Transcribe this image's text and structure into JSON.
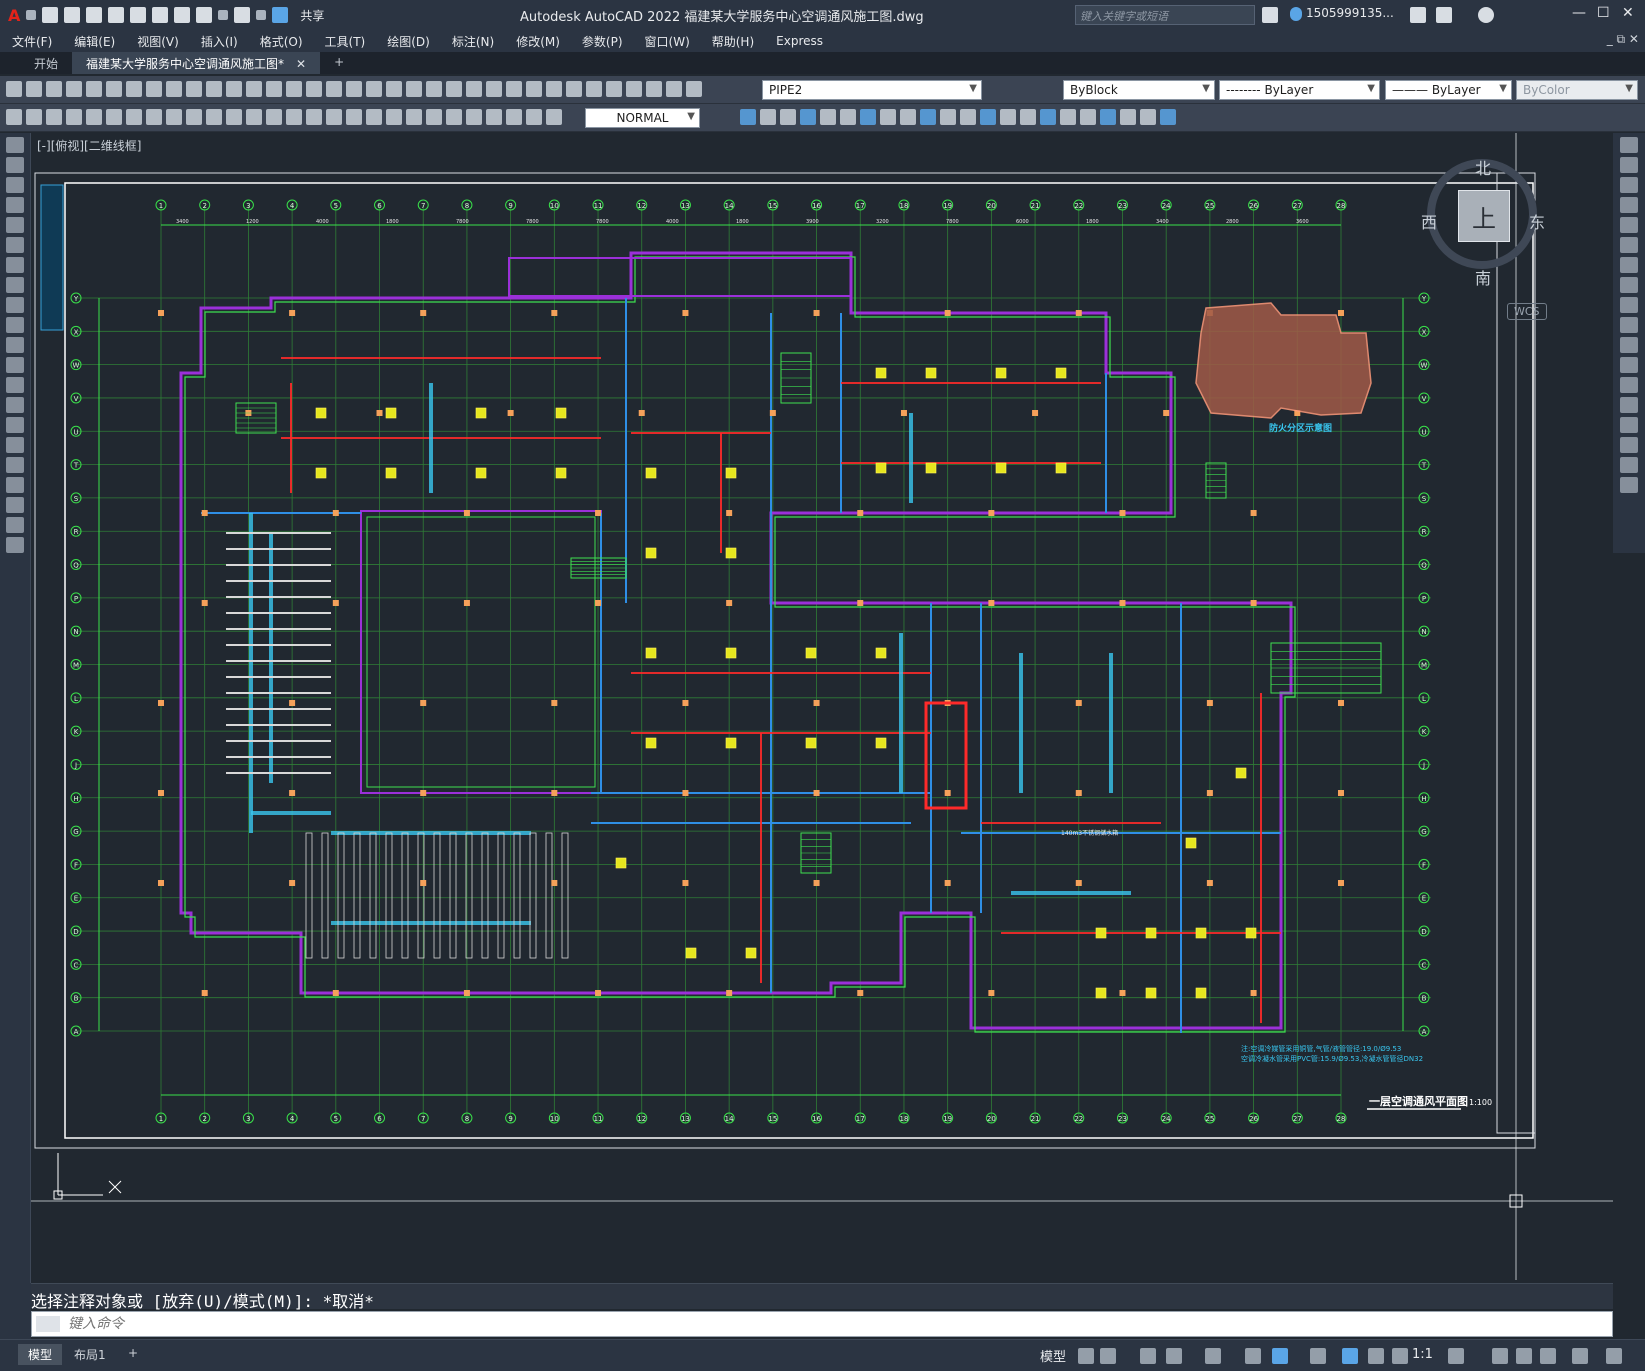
{
  "app": {
    "title": "Autodesk AutoCAD 2022    福建某大学服务中心空调通风施工图.dwg",
    "logo": "A",
    "share_label": "共享",
    "search_placeholder": "键入关键字或短语",
    "user": "1505999135...",
    "window_buttons": {
      "minimize": "—",
      "maximize": "☐",
      "close": "✕"
    }
  },
  "menu": {
    "items": [
      "文件(F)",
      "编辑(E)",
      "视图(V)",
      "插入(I)",
      "格式(O)",
      "工具(T)",
      "绘图(D)",
      "标注(N)",
      "修改(M)",
      "参数(P)",
      "窗口(W)",
      "帮助(H)",
      "Express"
    ],
    "window_controls": "_ ⧉ ✕"
  },
  "tabs": [
    {
      "label": "开始",
      "active": false
    },
    {
      "label": "福建某大学服务中心空调通风施工图*",
      "active": true
    }
  ],
  "tab_close": "✕",
  "tab_add": "+",
  "toolbar": {
    "layer": "PIPE2",
    "color": "ByBlock",
    "linetype": "-------- ByLayer",
    "lineweight": "——— ByLayer",
    "plotstyle": "ByColor",
    "dimstyle": "NORMAL"
  },
  "viewport_label": "[-][俯视][二维线框]",
  "viewcube": {
    "north": "北",
    "south": "南",
    "east": "东",
    "west": "西",
    "top": "上",
    "wcs": "WCS"
  },
  "drawing": {
    "title": "一层空调通风平面图",
    "scale": "1:100",
    "keyplan_label": "防火分区示意图",
    "note1": "注:空调冷媒管采用铜管,气管/液管管径:19.0/Ø9.53",
    "note2": "空调冷凝水管采用PVC管:15.9/Ø9.53,冷凝水管管径DN32",
    "room_note": "140m3不锈钢储水箱",
    "column_top": [
      "1",
      "2",
      "3",
      "4",
      "5",
      "6",
      "7",
      "8",
      "9",
      "10",
      "11",
      "12",
      "13",
      "14",
      "15",
      "16",
      "17",
      "18",
      "19",
      "20",
      "21",
      "22",
      "23",
      "24",
      "25",
      "26",
      "27",
      "28"
    ],
    "row_labels": [
      "Y",
      "X",
      "W",
      "V",
      "U",
      "T",
      "S",
      "R",
      "Q",
      "P",
      "N",
      "M",
      "L",
      "K",
      "J",
      "H",
      "G",
      "F",
      "E",
      "D",
      "C",
      "B",
      "A"
    ],
    "dims": [
      "3400",
      "1200",
      "4000",
      "1800",
      "7800",
      "7800",
      "7800",
      "4000",
      "1800",
      "3900",
      "3200",
      "7800",
      "6000",
      "1800",
      "3400",
      "2800",
      "3600"
    ]
  },
  "command": {
    "history": "选择注释对象或 [放弃(U)/模式(M)]: *取消*",
    "placeholder": "键入命令"
  },
  "status": {
    "layouts": [
      {
        "label": "模型",
        "active": true
      },
      {
        "label": "布局1",
        "active": false
      }
    ],
    "add": "+",
    "model": "模型",
    "scale": "1:1"
  }
}
